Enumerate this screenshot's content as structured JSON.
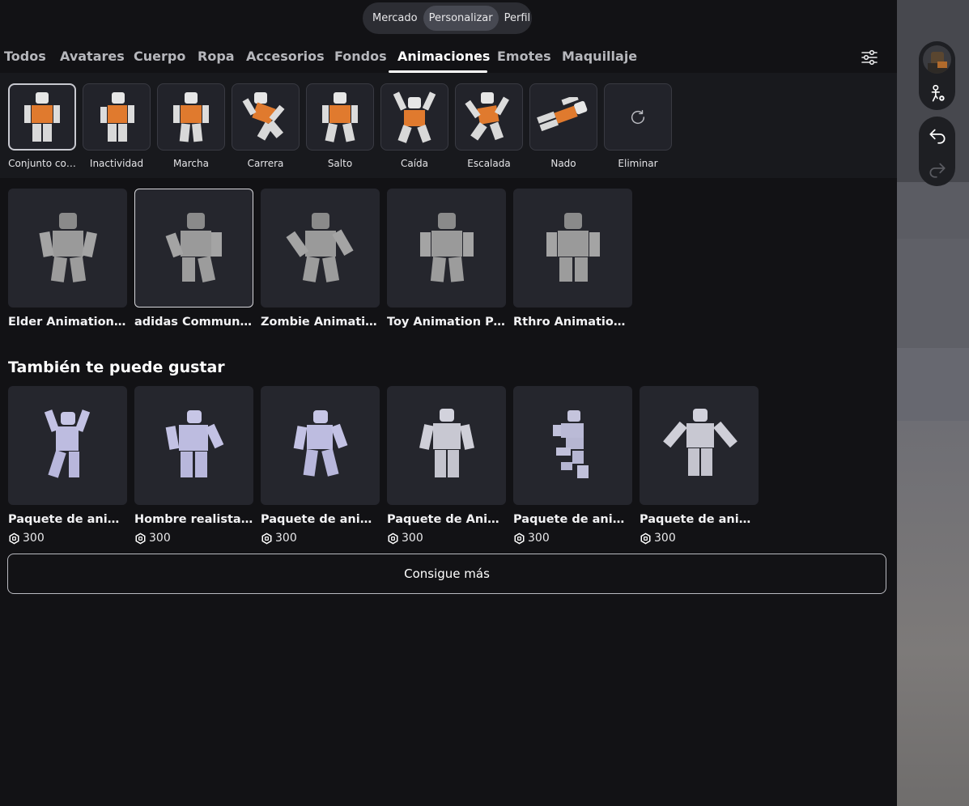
{
  "top_nav": [
    "Mercado",
    "Personalizar",
    "Perfil"
  ],
  "top_nav_active": "Personalizar",
  "tabs": [
    "Todos",
    "Avatares",
    "Cuerpo",
    "Ropa",
    "Accesorios",
    "Fondos",
    "Animaciones",
    "Emotes",
    "Maquillaje"
  ],
  "active_tab": "Animaciones",
  "subcategories": [
    "Conjunto co…",
    "Inactividad",
    "Marcha",
    "Carrera",
    "Salto",
    "Caída",
    "Escalada",
    "Nado",
    "Eliminar"
  ],
  "owned_items": [
    "Elder Animation P…",
    "adidas Community",
    "Zombie Animation …",
    "Toy Animation Pack",
    "Rthro Animation P…"
  ],
  "recommend_title": "También te puede gustar",
  "recommended": [
    {
      "title": "Paquete de anima…",
      "price": "300"
    },
    {
      "title": "Hombre realista 01",
      "price": "300"
    },
    {
      "title": "Paquete de anima…",
      "price": "300"
    },
    {
      "title": "Paquete de Anima…",
      "price": "300"
    },
    {
      "title": "Paquete de anima…",
      "price": "300"
    },
    {
      "title": "Paquete de anima…",
      "price": "300"
    }
  ],
  "more_button": "Consigue más",
  "colors": {
    "background": "#121215",
    "panel": "#18191d",
    "tile": "#25262d",
    "accent_orange": "#e07a2e"
  }
}
